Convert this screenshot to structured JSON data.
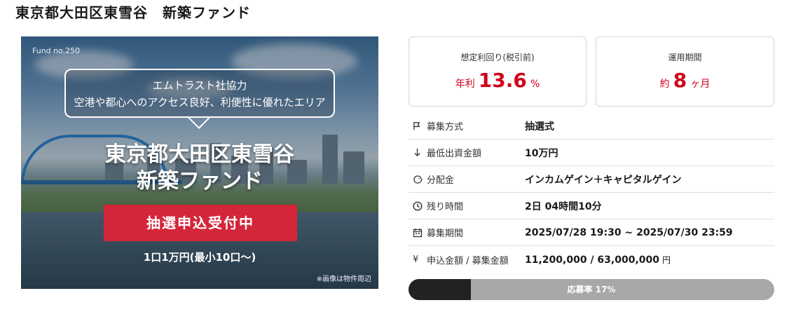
{
  "page": {
    "title": "東京都大田区東雪谷　新築ファンド"
  },
  "hero": {
    "fund_no": "Fund no.250",
    "bubble_line1": "エムトラスト社協力",
    "bubble_line2": "空港や都心へのアクセス良好、利便性に優れたエリア",
    "headline_line1": "東京都大田区東雪谷",
    "headline_line2": "新築ファンド",
    "cta": "抽選申込受付中",
    "unit_text": "1口1万円(最小10口〜)",
    "note": "※画像は物件周辺"
  },
  "cards": {
    "yield": {
      "label": "想定利回り(税引前)",
      "prefix": "年利",
      "value": "13.6",
      "suffix": "%"
    },
    "period": {
      "label": "運用期間",
      "prefix": "約",
      "value": "8",
      "suffix": "ヶ月"
    }
  },
  "info": {
    "rows": [
      {
        "icon": "flag-icon",
        "label": "募集方式",
        "value": "抽選式"
      },
      {
        "icon": "arrow-down-icon",
        "label": "最低出資金額",
        "value": "10万円"
      },
      {
        "icon": "piggy-bank-icon",
        "label": "分配金",
        "value": "インカムゲイン＋キャピタルゲイン"
      },
      {
        "icon": "clock-icon",
        "label": "残り時間",
        "value": "2日 04時間10分"
      },
      {
        "icon": "calendar-icon",
        "label": "募集期間",
        "value": "2025/07/28 19:30 ~ 2025/07/30 23:59"
      },
      {
        "icon": "yen-icon",
        "label": "申込金額 / 募集金額",
        "value": "11,200,000 / 63,000,000",
        "unit": "円"
      }
    ]
  },
  "progress": {
    "label": "応募率 17%",
    "fraction": 0.17
  },
  "colors": {
    "accent_red": "#d0021b",
    "cta_red": "#d4263a",
    "progress_fill": "#222222",
    "progress_track": "#a8a8a8"
  }
}
